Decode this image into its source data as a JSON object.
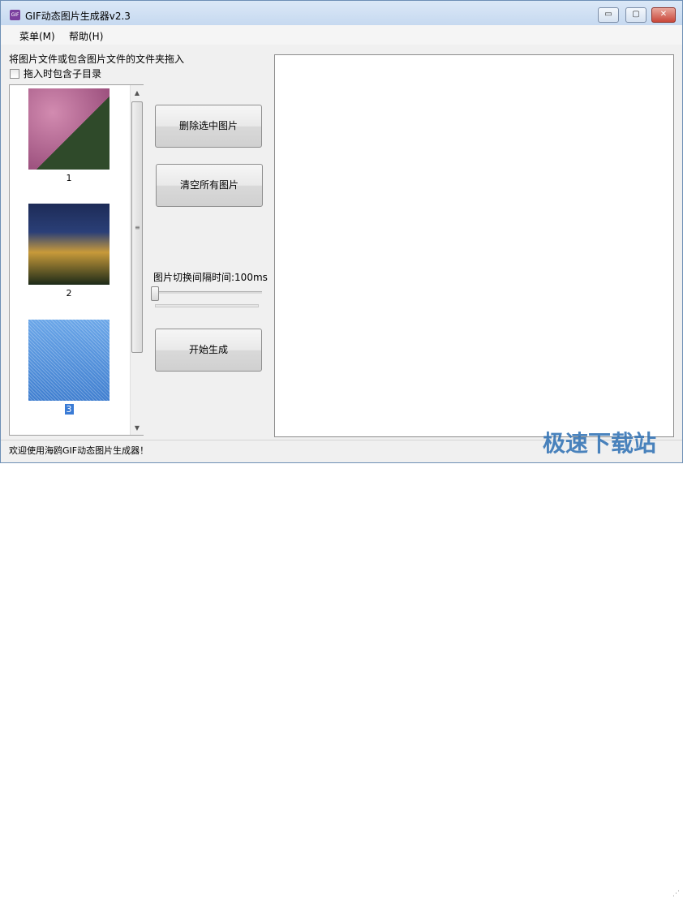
{
  "window": {
    "title": "GIF动态图片生成器v2.3",
    "icon_text": "GIF",
    "minimize_glyph": "▭",
    "maximize_glyph": "▢",
    "close_glyph": "✕"
  },
  "menu": {
    "main": "菜单(M)",
    "help": "帮助(H)"
  },
  "hint": "将图片文件或包含图片文件的文件夹拖入",
  "include_subdirs_label": "拖入时包含子目录",
  "images": [
    {
      "label": "1"
    },
    {
      "label": "2"
    },
    {
      "label": "3",
      "selected": true
    }
  ],
  "scrollbar": {
    "up_glyph": "▲",
    "down_glyph": "▼",
    "grip_glyph": "≡"
  },
  "buttons": {
    "delete_selected": "删除选中图片",
    "clear_all": "清空所有图片",
    "start": "开始生成"
  },
  "interval": {
    "label": "图片切换间隔时间:",
    "value": "100ms"
  },
  "status": "欢迎使用海鸥GIF动态图片生成器！",
  "watermark": "极速下载站",
  "resize_grip_glyph": "⋰",
  "colors": {
    "selection": "#3a7bd5",
    "close_button": "#c9473a",
    "title_bar": "#c6d9f0"
  }
}
